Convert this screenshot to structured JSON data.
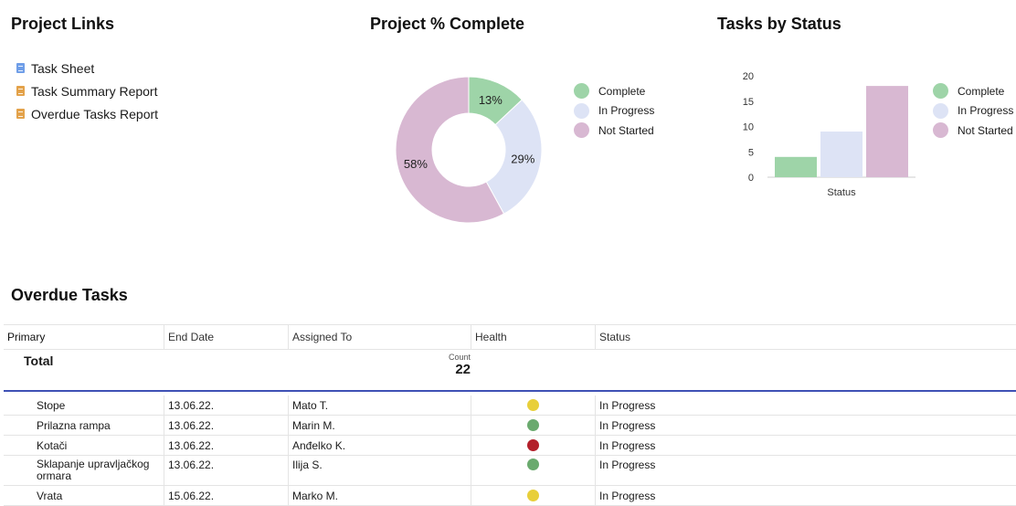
{
  "project_links": {
    "title": "Project Links",
    "items": [
      {
        "label": "Task Sheet",
        "icon": "sheet-icon"
      },
      {
        "label": "Task Summary Report",
        "icon": "report-icon"
      },
      {
        "label": "Overdue Tasks Report",
        "icon": "report-icon"
      }
    ]
  },
  "colors": {
    "complete": "#9ed4a8",
    "in_progress": "#dde3f5",
    "not_started": "#d8b8d2",
    "accent": "#3f51b5",
    "health_yellow": "#e8cf3a",
    "health_green": "#6aaa6e",
    "health_red": "#b3202b"
  },
  "pie_section": {
    "title": "Project % Complete",
    "legend": [
      "Complete",
      "In Progress",
      "Not Started"
    ]
  },
  "bar_section": {
    "title": "Tasks by Status",
    "legend": [
      "Complete",
      "In Progress",
      "Not Started"
    ]
  },
  "chart_data": [
    {
      "type": "pie",
      "title": "Project % Complete",
      "labels": [
        "Complete",
        "In Progress",
        "Not Started"
      ],
      "values": [
        13,
        29,
        58
      ],
      "value_labels": [
        "13%",
        "29%",
        "58%"
      ],
      "donut": true,
      "legend_position": "right"
    },
    {
      "type": "bar",
      "title": "Tasks by Status",
      "categories": [
        "Status"
      ],
      "series": [
        {
          "name": "Complete",
          "values": [
            4
          ]
        },
        {
          "name": "In Progress",
          "values": [
            9
          ]
        },
        {
          "name": "Not Started",
          "values": [
            18
          ]
        }
      ],
      "xlabel": "",
      "ylabel": "",
      "ylim": [
        0,
        20
      ],
      "yticks": [
        "0",
        "5",
        "10",
        "15",
        "20"
      ],
      "xtick_label": "Status",
      "grid": false,
      "legend_position": "right"
    }
  ],
  "overdue": {
    "title": "Overdue Tasks",
    "columns": [
      "Primary",
      "End Date",
      "Assigned To",
      "Health",
      "Status"
    ],
    "total_label": "Total",
    "count_label": "Count",
    "count_value": "22",
    "rows": [
      {
        "primary": "Stope",
        "end_date": "13.06.22.",
        "assigned": "Mato T.",
        "health": "yellow",
        "status": "In Progress"
      },
      {
        "primary": "Prilazna rampa",
        "end_date": "13.06.22.",
        "assigned": "Marin M.",
        "health": "green",
        "status": "In Progress"
      },
      {
        "primary": "Kotači",
        "end_date": "13.06.22.",
        "assigned": "Anđelko K.",
        "health": "red",
        "status": "In Progress"
      },
      {
        "primary": "Sklapanje upravljačkog ormara",
        "end_date": "13.06.22.",
        "assigned": "Ilija S.",
        "health": "green",
        "status": "In Progress"
      },
      {
        "primary": "Vrata",
        "end_date": "15.06.22.",
        "assigned": "Marko M.",
        "health": "yellow",
        "status": "In Progress"
      }
    ]
  }
}
